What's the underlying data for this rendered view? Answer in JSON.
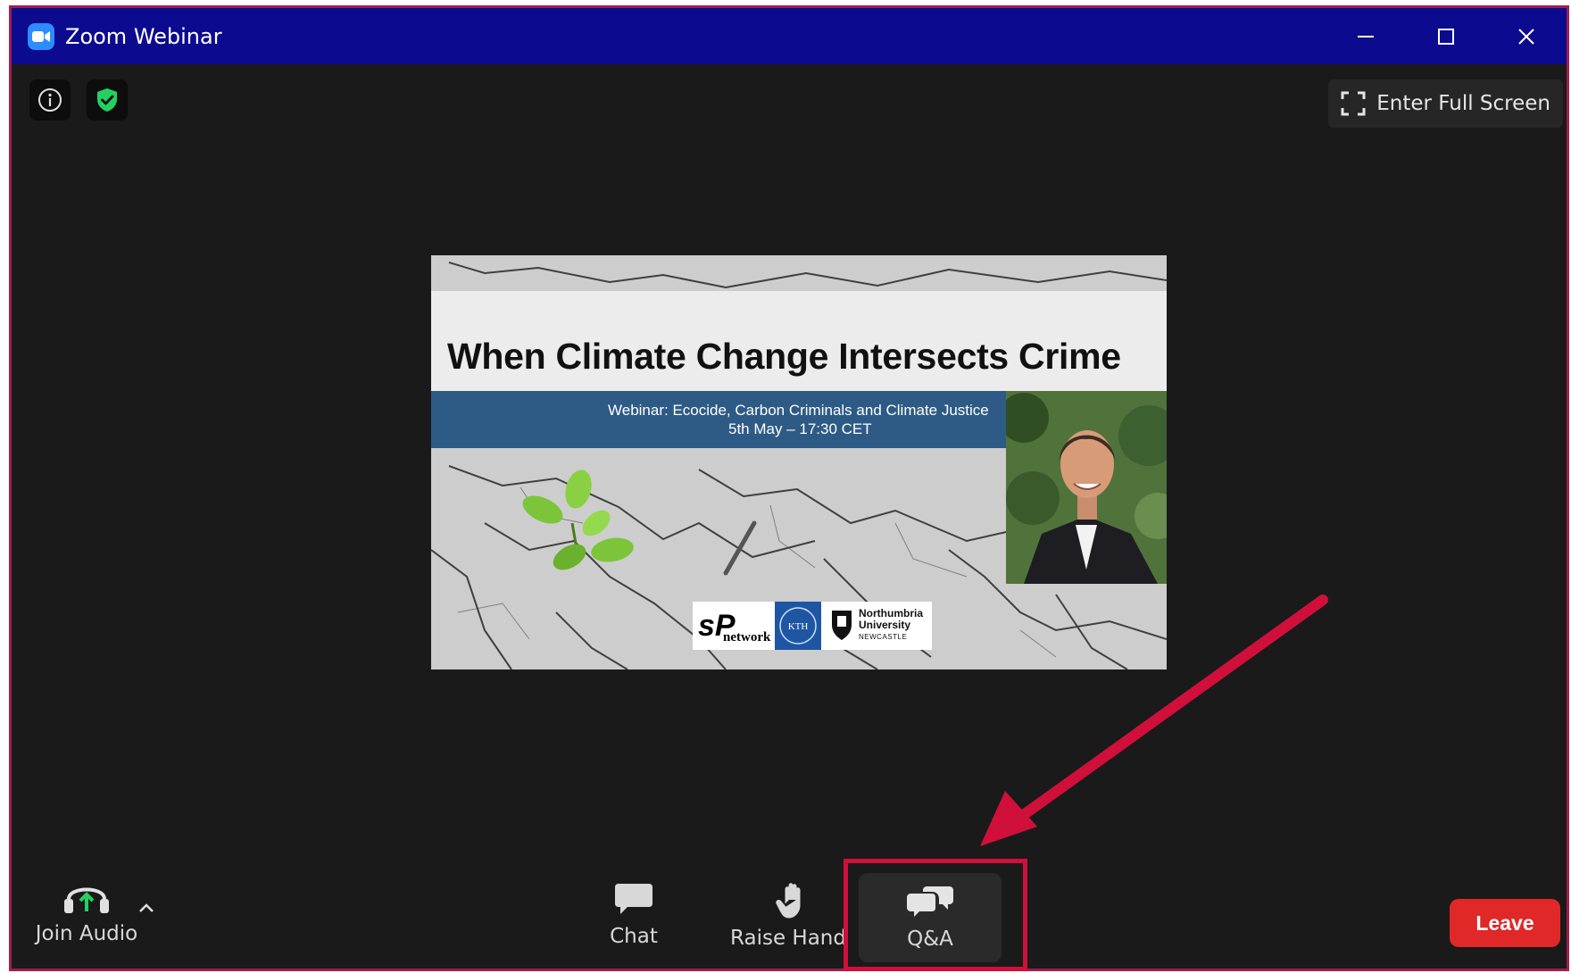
{
  "window": {
    "title": "Zoom Webinar",
    "accent_color": "#0c0a8e",
    "controls": [
      "minimize-icon",
      "maximize-icon",
      "close-icon"
    ]
  },
  "top_bar": {
    "info_icon": "info-icon",
    "security_icon": "shield-check-icon",
    "fullscreen_label": "Enter Full Screen"
  },
  "slide": {
    "title": "When Climate Change Intersects Crime",
    "subtitle_line1": "Webinar: Ecocide, Carbon Criminals and Climate Justice",
    "subtitle_line2": "5th May – 17:30 CET",
    "logos": {
      "sp": "sP",
      "sp_suffix": "network",
      "kth": "KTH",
      "northumbria_name": "Northumbria University",
      "northumbria_sub": "NEWCASTLE"
    }
  },
  "toolbar": {
    "join_audio_label": "Join Audio",
    "chat_label": "Chat",
    "raise_hand_label": "Raise Hand",
    "qa_label": "Q&A",
    "leave_label": "Leave",
    "leave_color": "#e02828",
    "highlight_color": "#d0103a"
  }
}
